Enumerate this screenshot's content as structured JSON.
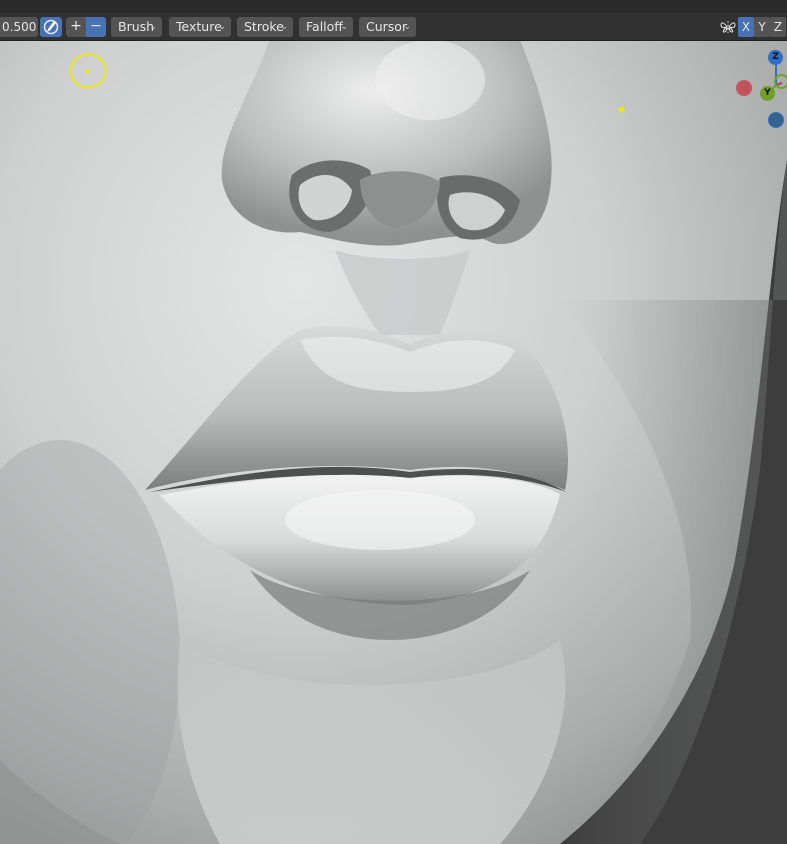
{
  "header": {
    "strength_value": "0.500",
    "add_label": "+",
    "subtract_label": "−",
    "menus": [
      "Brush",
      "Texture",
      "Stroke",
      "Falloff",
      "Cursor"
    ],
    "symmetry_axes": [
      "X",
      "Y",
      "Z"
    ],
    "active_axis": "X",
    "chevron": "⌄"
  },
  "gizmo": {
    "z_label": "Z",
    "y_label": "Y",
    "x_color": "#c6343f",
    "y_color": "#6fa02a",
    "z_color": "#2f6fc7",
    "neg_z_color": "#35628f"
  },
  "colors": {
    "header_bg": "#303030",
    "field_bg": "#545454",
    "accent_blue": "#4772b3",
    "brush_cursor": "#f2e41c",
    "text": "#e6e6e6"
  }
}
